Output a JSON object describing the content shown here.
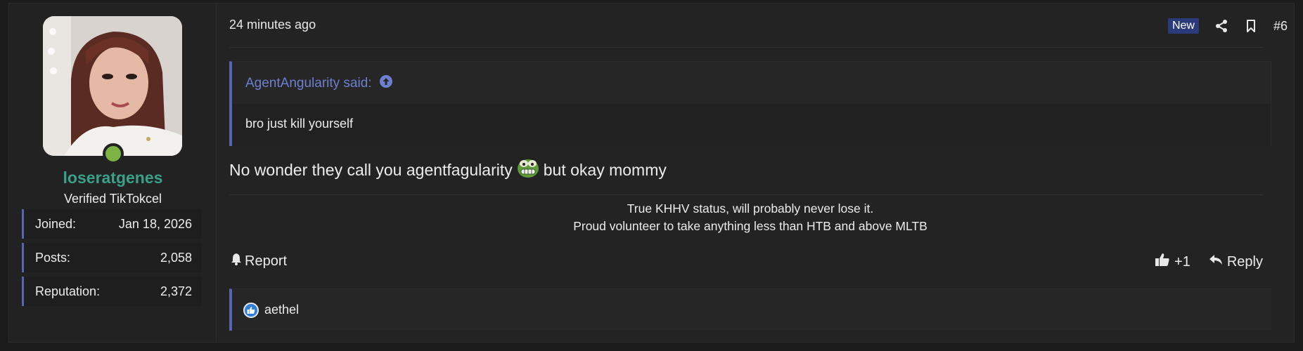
{
  "user": {
    "username": "loseratgenes",
    "title": "Verified TikTokcel",
    "stats": [
      {
        "label": "Joined:",
        "value": "Jan 18, 2026"
      },
      {
        "label": "Posts:",
        "value": "2,058"
      },
      {
        "label": "Reputation:",
        "value": "2,372"
      }
    ],
    "online": true
  },
  "post": {
    "time": "24 minutes ago",
    "badge": "New",
    "number": "#6",
    "quote": {
      "author_line": "AgentAngularity said:",
      "text": "bro just kill yourself"
    },
    "message_before": "No wonder they call you agentfagularity",
    "message_after": "but okay mommy",
    "signature_lines": [
      "True KHHV status, will probably never lose it.",
      "Proud volunteer to take anything less than HTB and above MLTB"
    ]
  },
  "actions": {
    "report_label": "Report",
    "like_label": "+1",
    "reply_label": "Reply"
  },
  "reactions": {
    "users": "aethel"
  },
  "colors": {
    "accent": "#5865b5",
    "username": "#3aa08a",
    "quote_author": "#6e7fd0",
    "online": "#7cb342",
    "badge_bg": "#2b3a7a"
  },
  "icons": {
    "share": "share-icon",
    "bookmark": "bookmark-icon",
    "quote_jump": "arrow-up-circle-icon",
    "report": "bell-icon",
    "like": "thumbs-up-icon",
    "reply": "reply-icon",
    "emoji": "pepe-emoji-icon"
  }
}
